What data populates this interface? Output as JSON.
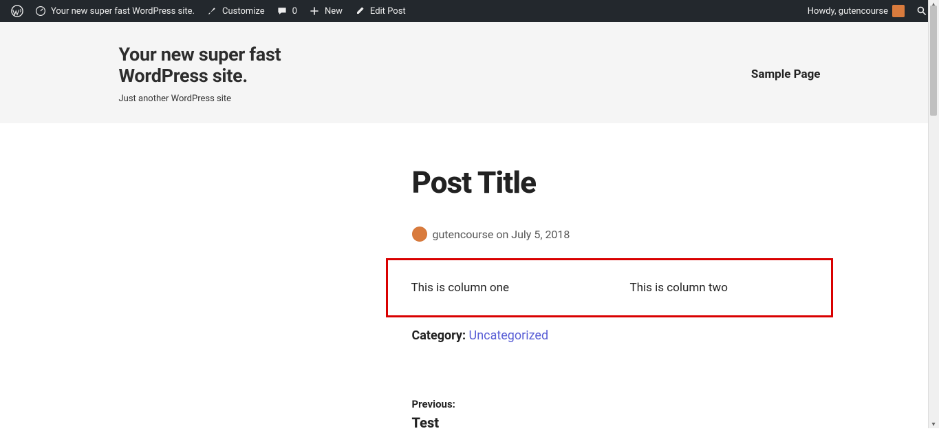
{
  "adminbar": {
    "site_name": "Your new super fast WordPress site.",
    "customize": "Customize",
    "comments_count": "0",
    "new": "New",
    "edit_post": "Edit Post",
    "howdy": "Howdy, gutencourse"
  },
  "site": {
    "title": "Your new super fast WordPress site.",
    "tagline": "Just another WordPress site",
    "nav": {
      "sample_page": "Sample Page"
    }
  },
  "post": {
    "title": "Post Title",
    "author": "gutencourse",
    "on": "on",
    "date": "July 5, 2018",
    "columns": {
      "col1": "This is column one",
      "col2": "This is column two"
    },
    "category_label": "Category:",
    "category_value": "Uncategorized",
    "prev_label": "Previous:",
    "prev_title": "Test"
  }
}
